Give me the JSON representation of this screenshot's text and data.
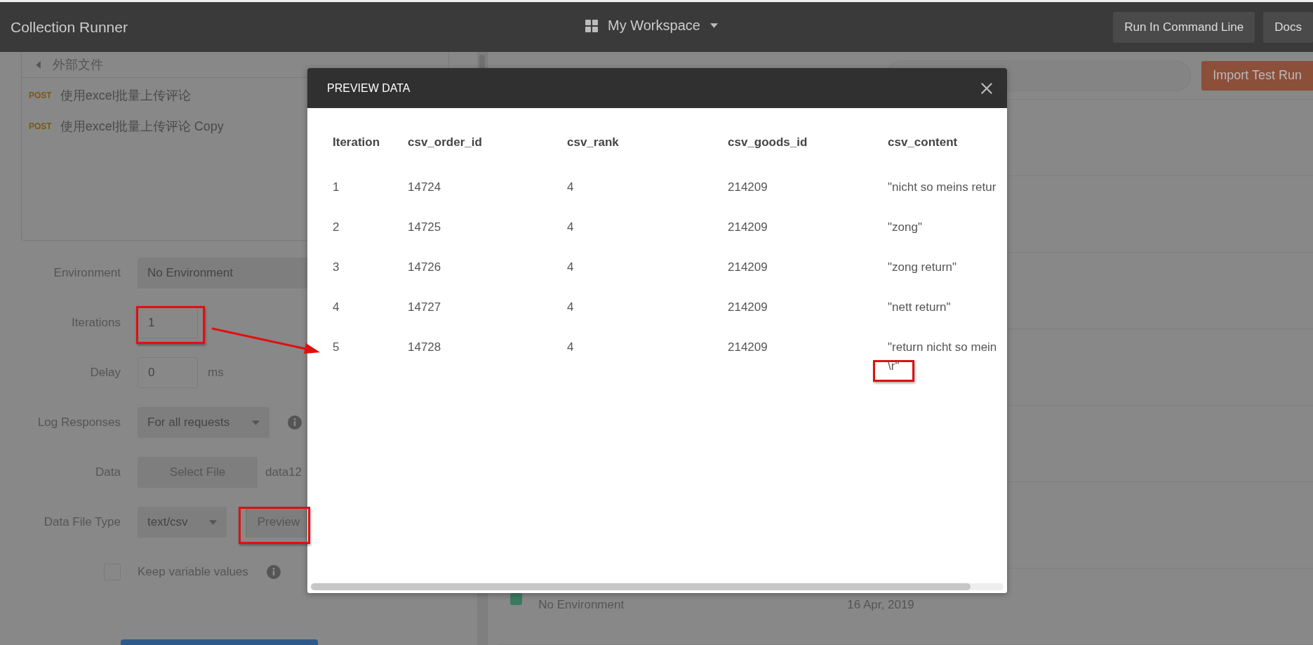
{
  "header": {
    "title": "Collection Runner",
    "workspace": "My Workspace",
    "buttons": [
      "Run In Command Line",
      "Docs"
    ]
  },
  "collection": {
    "folder": "外部文件",
    "requests": [
      {
        "method": "POST",
        "name": "使用excel批量上传评论"
      },
      {
        "method": "POST",
        "name": "使用excel批量上传评论 Copy"
      }
    ]
  },
  "settings": {
    "environment": {
      "label": "Environment",
      "value": "No Environment"
    },
    "iterations": {
      "label": "Iterations",
      "value": "1"
    },
    "delay": {
      "label": "Delay",
      "value": "0",
      "unit": "ms"
    },
    "log_responses": {
      "label": "Log Responses",
      "value": "For all requests"
    },
    "data": {
      "label": "Data",
      "button": "Select File",
      "file": "data12"
    },
    "data_file_type": {
      "label": "Data File Type",
      "value": "text/csv",
      "button": "Preview"
    },
    "keep_variables": {
      "label": "Keep variable values",
      "checked": false
    }
  },
  "runs_panel": {
    "import_button": "Import Test Run",
    "runs": [
      {
        "environment": "No Environment",
        "date": "16 Apr, 2019"
      }
    ]
  },
  "preview": {
    "title": "PREVIEW DATA",
    "columns": [
      "Iteration",
      "csv_order_id",
      "csv_rank",
      "csv_goods_id",
      "csv_content"
    ],
    "rows": [
      [
        "1",
        "14724",
        "4",
        "214209",
        "\"nicht so meins retur"
      ],
      [
        "2",
        "14725",
        "4",
        "214209",
        "\"zong\""
      ],
      [
        "3",
        "14726",
        "4",
        "214209",
        "\"zong return\""
      ],
      [
        "4",
        "14727",
        "4",
        "214209",
        "\"nett return\""
      ],
      [
        "5",
        "14728",
        "4",
        "214209",
        "\"return nicht so mein\n\\r\""
      ]
    ]
  }
}
